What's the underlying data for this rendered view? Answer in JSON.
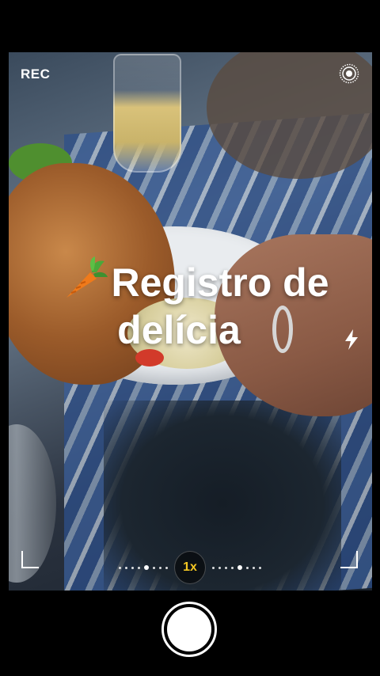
{
  "camera": {
    "rec_label": "REC",
    "caption_line1": "Registro de",
    "caption_line2": "delícia",
    "zoom_label": "1x",
    "caption_emoji": "carrot-icon",
    "icons": [
      "live-photo-icon",
      "flash-icon",
      "carrot-icon"
    ],
    "accent_color": "#f3c623"
  }
}
